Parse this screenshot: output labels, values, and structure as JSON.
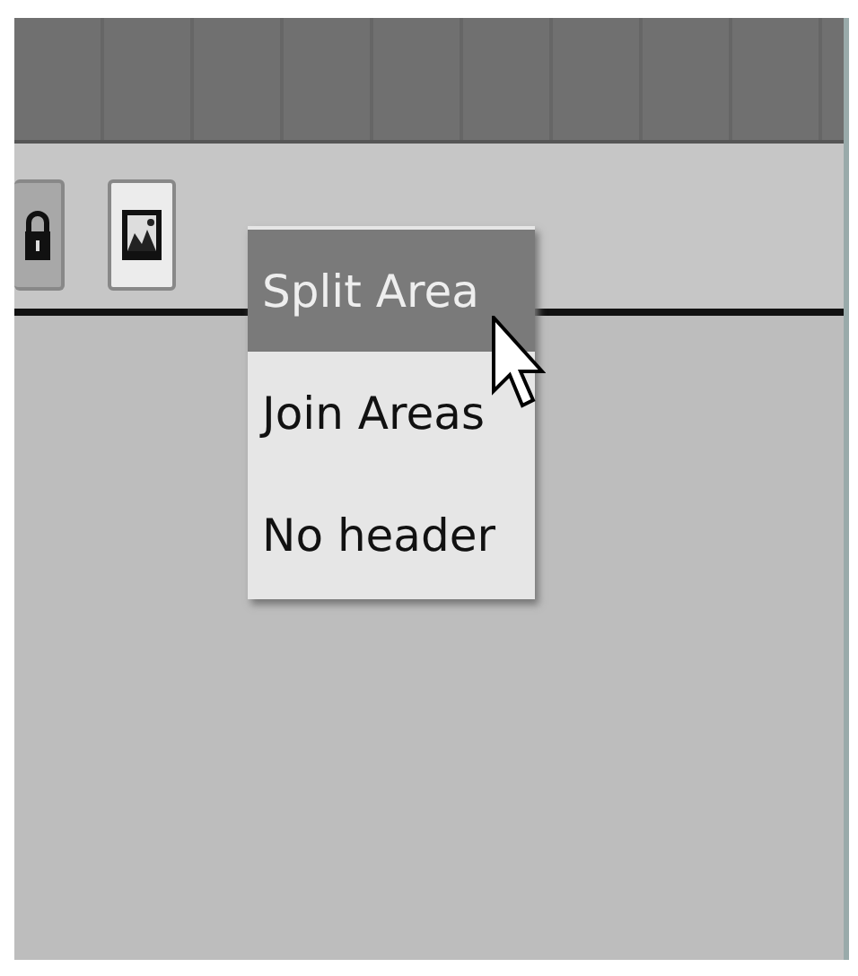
{
  "header": {
    "buttons": [
      {
        "kind": "lock",
        "selected": true
      },
      {
        "kind": "image",
        "selected": false
      }
    ]
  },
  "menu": {
    "items": [
      {
        "label": "Split Area",
        "selected": true
      },
      {
        "label": "Join Areas",
        "selected": false
      },
      {
        "label": "No header",
        "selected": false
      }
    ]
  }
}
